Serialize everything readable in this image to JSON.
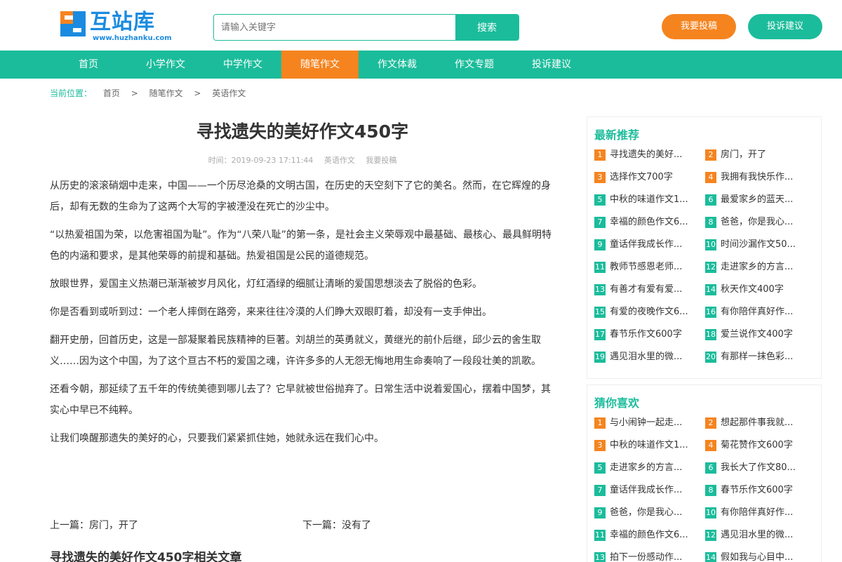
{
  "header": {
    "logo_name": "互站库",
    "logo_url": "www.huzhanku.com",
    "search_placeholder": "请输入关键字",
    "search_button": "搜索",
    "submit_button": "我要投稿",
    "complain_button": "投诉建议"
  },
  "nav": {
    "items": [
      "首页",
      "小学作文",
      "中学作文",
      "随笔作文",
      "作文体裁",
      "作文专题",
      "投诉建议"
    ],
    "active_index": 3
  },
  "breadcrumb": {
    "label": "当前位置：",
    "items": [
      "首页",
      ">",
      "随笔作文",
      ">",
      "英语作文"
    ]
  },
  "article": {
    "title": "寻找遗失的美好作文450字",
    "time": "时间：2019-09-23 17:11:44",
    "category": "英语作文",
    "submit": "我要投稿",
    "paragraphs": [
      "从历史的滚滚硝烟中走来，中国——一个历尽沧桑的文明古国，在历史的天空刻下了它的美名。然而，在它辉煌的身后，却有无数的生命为了这两个大写的字被湮没在死亡的沙尘中。",
      "“以热爱祖国为荣，以危害祖国为耻”。作为“八荣八耻”的第一条，是社会主义荣辱观中最基础、最核心、最具鲜明特色的内涵和要求，是其他荣辱的前提和基础。热爱祖国是公民的道德规范。",
      "放眼世界，爱国主义热潮已渐渐被岁月风化，灯红酒绿的细腻让清晰的爱国思想淡去了脱俗的色彩。",
      "你是否看到或听到过：一个老人摔倒在路旁，来来往往冷漠的人们睁大双眼盯着，却没有一支手伸出。",
      "翻开史册，回首历史，这是一部凝聚着民族精神的巨著。刘胡兰的英勇就义，黄继光的前仆后继，邱少云的舍生取义……因为这个中国，为了这个亘古不朽的爱国之魂，许许多多的人无怨无悔地用生命奏响了一段段壮美的凯歌。",
      "还看今朝，那延续了五千年的传统美德到哪儿去了？它早就被世俗抛弃了。日常生活中说着爱国心，摆着中国梦，其实心中早已不纯粹。",
      "让我们唤醒那遗失的美好的心，只要我们紧紧抓住她，她就永远在我们心中。"
    ],
    "prev": "上一篇：房门，开了",
    "next": "下一篇：没有了",
    "related_title": "寻找遗失的美好作文450字相关文章"
  },
  "sidebar": {
    "latest_title": "最新推荐",
    "latest": [
      "寻找遗失的美好...",
      "房门，开了",
      "选择作文700字",
      "我拥有我快乐作...",
      "中秋的味道作文1...",
      "最爱家乡的蓝天...",
      "幸福的颜色作文6...",
      "爸爸，你是我心...",
      "童话伴我成长作...",
      "时间沙漏作文50...",
      "教师节感恩老师...",
      "走进家乡的方言...",
      "有善才有爱有爱...",
      "秋天作文400字",
      "有爱的夜晚作文6...",
      "有你陪伴真好作...",
      "春节乐作文600字",
      "爱兰说作文400字",
      "遇见泪水里的微...",
      "有那样一抹色彩..."
    ],
    "guess_title": "猜你喜欢",
    "guess": [
      "与小闹钟一起走...",
      "想起那件事我就...",
      "中秋的味道作文1...",
      "菊花赞作文600字",
      "走进家乡的方言...",
      "我长大了作文80...",
      "童话伴我成长作...",
      "春节乐作文600字",
      "爸爸，你是我心...",
      "有你陪伴真好作...",
      "幸福的颜色作文6...",
      "遇见泪水里的微...",
      "拍下一份感动作...",
      "假如我与心目中..."
    ],
    "colors": {
      "top3": "#f5841f",
      "rest": "#1bbc9b"
    }
  }
}
